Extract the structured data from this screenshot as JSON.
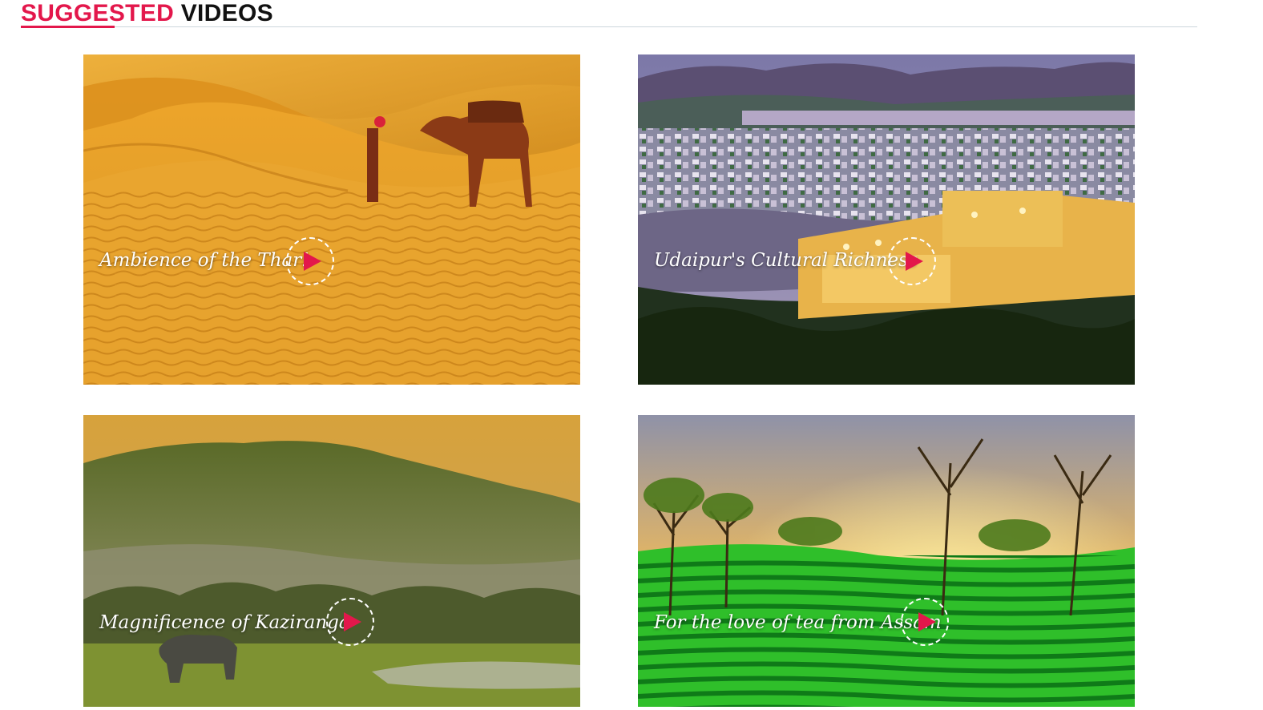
{
  "header": {
    "title_accent": "SUGGESTED",
    "title_main": "VIDEOS"
  },
  "colors": {
    "accent": "#e3174b",
    "rule": "#ccd6dc"
  },
  "videos": [
    {
      "title": "Ambience of the Thar!",
      "play_icon": "play-icon"
    },
    {
      "title": "Udaipur's Cultural Richness",
      "play_icon": "play-icon"
    },
    {
      "title": "Magnificence of Kaziranga",
      "play_icon": "play-icon"
    },
    {
      "title": "For the love of tea from Assam",
      "play_icon": "play-icon"
    }
  ]
}
